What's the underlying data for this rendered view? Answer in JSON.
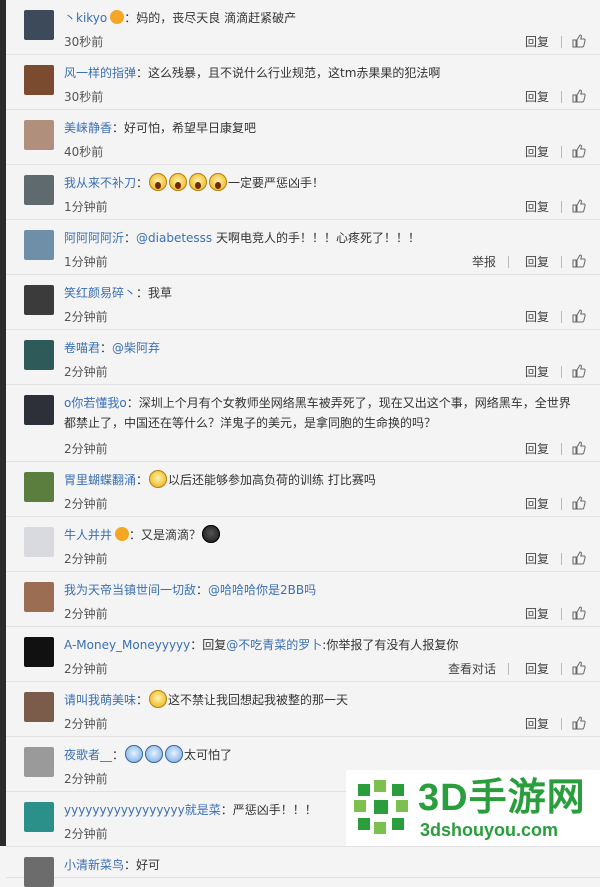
{
  "actions": {
    "reply": "回复",
    "report": "举报",
    "view_chat": "查看对话"
  },
  "comments": [
    {
      "user": "丶kikyo",
      "badge": true,
      "segments": [
        {
          "t": "：妈的，丧尽天良 滴滴赶紧破产"
        }
      ],
      "time": "30秒前",
      "avatar_color": "#3d4a5a",
      "h": 54
    },
    {
      "user": "风一样的指弹",
      "segments": [
        {
          "t": "：这么残暴，且不说什么行业规范，这tm赤果果的犯法啊"
        }
      ],
      "time": "30秒前",
      "avatar_color": "#7a4b2e",
      "h": 54
    },
    {
      "user": "美崃静香",
      "segments": [
        {
          "t": "：好可怕，希望早日康复吧"
        }
      ],
      "time": "40秒前",
      "avatar_color": "#b08f7c",
      "h": 54
    },
    {
      "user": "我从来不补刀",
      "segments": [
        {
          "t": "："
        },
        {
          "e": "scream"
        },
        {
          "e": "scream"
        },
        {
          "e": "scream"
        },
        {
          "e": "scream"
        },
        {
          "t": "一定要严惩凶手！"
        }
      ],
      "time": "1分钟前",
      "avatar_color": "#5f6a6f",
      "h": 54
    },
    {
      "user": "阿阿阿阿沂",
      "segments": [
        {
          "t": "："
        },
        {
          "m": "@diabetesss"
        },
        {
          "t": " 天啊电竞人的手！！！心疼死了！！！"
        }
      ],
      "time": "1分钟前",
      "avatar_color": "#6f8fa8",
      "report": true,
      "h": 54
    },
    {
      "user": "笑红颜易碎丶",
      "segments": [
        {
          "t": "：我草"
        }
      ],
      "time": "2分钟前",
      "avatar_color": "#3b3b3b",
      "h": 54
    },
    {
      "user": "卷喵君",
      "segments": [
        {
          "t": "："
        },
        {
          "m": "@柴阿弃"
        }
      ],
      "time": "2分钟前",
      "avatar_color": "#2f5a5a",
      "h": 54
    },
    {
      "user": "o你若懂我o",
      "segments": [
        {
          "t": "：深圳上个月有个女教师坐网络黑车被弄死了，现在又出这个事，网络黑车，全世界都禁止了，中国还在等什么？洋鬼子的美元，是拿同胞的生命换的吗？"
        }
      ],
      "time": "2分钟前",
      "avatar_color": "#2d3038",
      "wrap": true,
      "h": 76
    },
    {
      "user": "胃里蝴蝶翻涌",
      "segments": [
        {
          "t": "："
        },
        {
          "e": "plain"
        },
        {
          "t": "以后还能够参加高负荷的训练 打比赛吗"
        }
      ],
      "time": "2分钟前",
      "avatar_color": "#5b7d3d",
      "h": 54
    },
    {
      "user": "牛人并井",
      "badge": true,
      "segments": [
        {
          "t": "：又是滴滴？"
        },
        {
          "e": "dark"
        }
      ],
      "time": "2分钟前",
      "avatar_color": "#d9d9e0",
      "h": 54
    },
    {
      "user": "我为天帝当镇世间一切敌",
      "segments": [
        {
          "t": "："
        },
        {
          "m": "@哈哈哈你是2BB吗"
        }
      ],
      "time": "2分钟前",
      "avatar_color": "#9b6e53",
      "h": 54
    },
    {
      "user": "A-Money_Moneyyyyy",
      "segments": [
        {
          "t": "：回复"
        },
        {
          "m": "@不吃青菜的罗卜"
        },
        {
          "t": ":你举报了有没有人报复你"
        }
      ],
      "time": "2分钟前",
      "avatar_color": "#111111",
      "view_chat": true,
      "h": 54
    },
    {
      "user": "请叫我萌美味",
      "segments": [
        {
          "t": "："
        },
        {
          "e": "plain"
        },
        {
          "t": "这不禁让我回想起我被整的那一天"
        }
      ],
      "time": "2分钟前",
      "avatar_color": "#7b5b4a",
      "h": 54
    },
    {
      "user": "夜歌者__",
      "segments": [
        {
          "t": "："
        },
        {
          "e": "blue"
        },
        {
          "e": "blue"
        },
        {
          "e": "blue"
        },
        {
          "t": "太可怕了"
        }
      ],
      "time": "2分钟前",
      "avatar_color": "#9a9a9a",
      "h": 54
    },
    {
      "user": "yyyyyyyyyyyyyyyyy就是菜",
      "segments": [
        {
          "t": "：严惩凶手！！！"
        }
      ],
      "time": "2分钟前",
      "avatar_color": "#2b8f8a",
      "h": 54
    },
    {
      "user": "小清新菜鸟",
      "segments": [
        {
          "t": "：好可"
        }
      ],
      "time": "",
      "avatar_color": "#6c6c6c",
      "h": 30
    }
  ],
  "watermark": {
    "title": "3D手游网",
    "subtitle": "3dshouyou.com"
  }
}
